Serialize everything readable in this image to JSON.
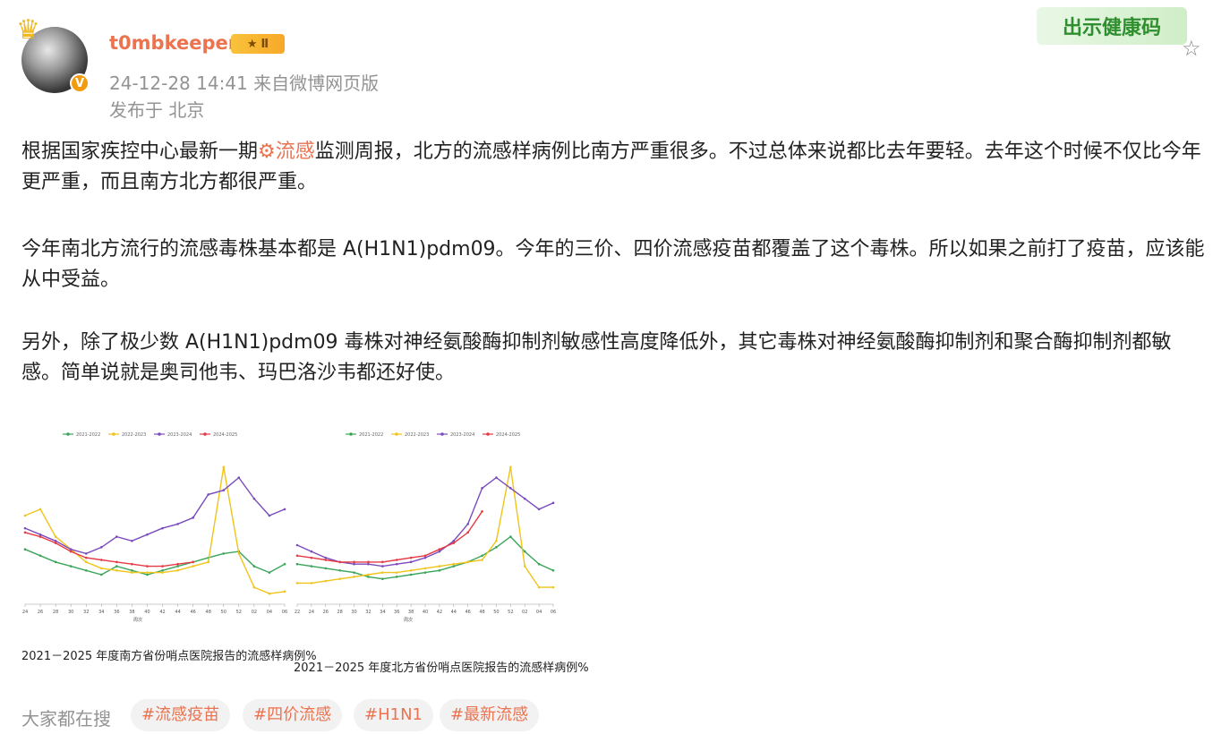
{
  "post": {
    "author": "t0mbkeeper",
    "level": "Ⅱ",
    "time_and_source": "24-12-28 14:41 来自微博网页版",
    "location": "发布于 北京",
    "health_code": "出示健康码",
    "paragraph1_before_topic": "根据国家疾控中心最新一期",
    "topic": "流感",
    "paragraph1_after_topic": "监测周报，北方的流感样病例比南方严重很多。不过总体来说都比去年要轻。去年这个时候不仅比今年更严重，而且南方北方都很严重。",
    "paragraph2": "今年南北方流行的流感毒株基本都是 A(H1N1)pdm09。今年的三价、四价流感疫苗都覆盖了这个毒株。所以如果之前打了疫苗，应该能从中受益。",
    "paragraph3": "另外，除了极少数 A(H1N1)pdm09 毒株对神经氨酸酶抑制剂敏感性高度降低外，其它毒株对神经氨酸酶抑制剂和聚合酶抑制剂都敏感。简单说就是奥司他韦、玛巴洛沙韦都还好使。"
  },
  "search": {
    "label": "大家都在搜",
    "tags": [
      "#流感疫苗",
      "#四价流感",
      "#H1N1",
      "#最新流感"
    ]
  },
  "icons": {
    "avatar_crown": "crown-icon",
    "verified": "verified-v-icon",
    "favorite": "star-outline-icon",
    "topic": "topic-gear-icon"
  },
  "colors": {
    "username": "#eb7350",
    "meta": "#939393",
    "series_2021": "#3aa55a",
    "series_2022": "#f0c419",
    "series_2023": "#7a4bbd",
    "series_2024": "#e63946"
  },
  "chart_data": [
    {
      "type": "line",
      "title": "2021－2025 年度南方省份哨点医院报告的流感样病例%",
      "xlabel": "周次",
      "x": [
        "24",
        "26",
        "28",
        "30",
        "32",
        "34",
        "36",
        "38",
        "40",
        "42",
        "44",
        "46",
        "48",
        "50",
        "52",
        "02",
        "04",
        "06"
      ],
      "series": [
        {
          "name": "2021-2022",
          "values": [
            5.6,
            5.3,
            5.0,
            4.8,
            4.6,
            4.4,
            4.8,
            4.6,
            4.4,
            4.6,
            4.8,
            5.0,
            5.2,
            5.4,
            5.5,
            4.8,
            4.5,
            4.9
          ]
        },
        {
          "name": "2022-2023",
          "values": [
            7.2,
            7.5,
            6.2,
            5.6,
            5.0,
            4.7,
            4.6,
            4.5,
            4.5,
            4.5,
            4.6,
            4.8,
            5.0,
            9.5,
            5.4,
            3.8,
            3.5,
            3.6
          ]
        },
        {
          "name": "2023-2024",
          "values": [
            6.6,
            6.3,
            6.0,
            5.6,
            5.4,
            5.7,
            6.2,
            6.0,
            6.3,
            6.6,
            6.8,
            7.1,
            8.2,
            8.4,
            9.0,
            8.0,
            7.2,
            7.5
          ]
        },
        {
          "name": "2024-2025",
          "values": [
            6.4,
            6.2,
            5.9,
            5.5,
            5.2,
            5.1,
            5.0,
            4.9,
            4.8,
            4.8,
            4.9,
            5.0,
            null,
            null,
            null,
            null,
            null,
            null
          ]
        }
      ]
    },
    {
      "type": "line",
      "title": "2021－2025 年度北方省份哨点医院报告的流感样病例%",
      "xlabel": "周次",
      "x": [
        "22",
        "24",
        "26",
        "28",
        "30",
        "32",
        "34",
        "36",
        "38",
        "40",
        "42",
        "44",
        "46",
        "48",
        "50",
        "52",
        "02",
        "04",
        "06"
      ],
      "series": [
        {
          "name": "2021-2022",
          "values": [
            4.9,
            4.8,
            4.7,
            4.6,
            4.5,
            4.3,
            4.2,
            4.3,
            4.4,
            4.5,
            4.6,
            4.8,
            5.0,
            5.3,
            5.7,
            6.2,
            5.5,
            4.9,
            4.6
          ]
        },
        {
          "name": "2022-2023",
          "values": [
            4.0,
            4.0,
            4.1,
            4.2,
            4.3,
            4.4,
            4.5,
            4.5,
            4.6,
            4.7,
            4.8,
            4.9,
            5.0,
            5.1,
            6.0,
            9.5,
            4.8,
            3.8,
            3.8
          ]
        },
        {
          "name": "2023-2024",
          "values": [
            5.8,
            5.5,
            5.2,
            5.0,
            4.9,
            4.9,
            4.8,
            4.9,
            5.0,
            5.2,
            5.5,
            6.0,
            6.8,
            8.5,
            9.0,
            8.5,
            8.0,
            7.5,
            7.8
          ]
        },
        {
          "name": "2024-2025",
          "values": [
            5.3,
            5.2,
            5.1,
            5.0,
            5.0,
            5.0,
            5.0,
            5.1,
            5.2,
            5.3,
            5.6,
            5.9,
            6.4,
            7.4,
            null,
            null,
            null,
            null,
            null
          ]
        }
      ]
    }
  ]
}
